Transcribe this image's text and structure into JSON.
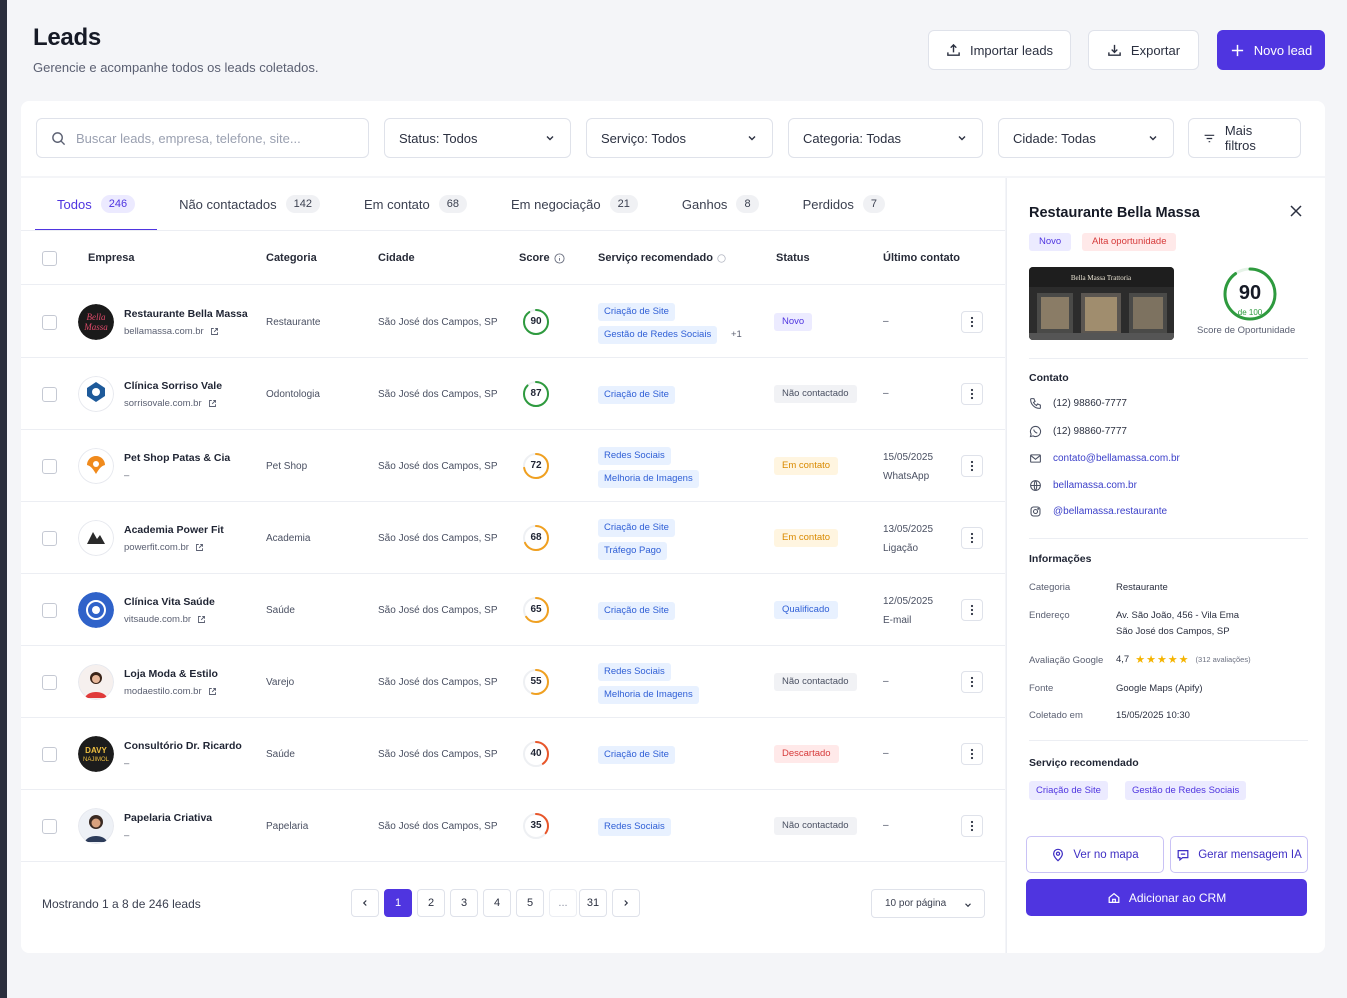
{
  "header": {
    "title": "Leads",
    "subtitle": "Gerencie e acompanhe todos os leads coletados.",
    "import_label": "Importar leads",
    "export_label": "Exportar",
    "new_label": "Novo lead"
  },
  "filters": {
    "search_placeholder": "Buscar leads, empresa, telefone, site...",
    "status": "Status: Todos",
    "service": "Serviço: Todos",
    "category": "Categoria: Todas",
    "city": "Cidade: Todas",
    "more": "Mais filtros"
  },
  "tabs": [
    {
      "label": "Todos",
      "count": "246"
    },
    {
      "label": "Não contactados",
      "count": "142"
    },
    {
      "label": "Em contato",
      "count": "68"
    },
    {
      "label": "Em negociação",
      "count": "21"
    },
    {
      "label": "Ganhos",
      "count": "8"
    },
    {
      "label": "Perdidos",
      "count": "7"
    }
  ],
  "columns": {
    "company": "Empresa",
    "category": "Categoria",
    "city": "Cidade",
    "score": "Score",
    "service": "Serviço recomendado",
    "status": "Status",
    "last_contact": "Último contato"
  },
  "rows": [
    {
      "name": "Restaurante Bella Massa",
      "site": "bellamassa.com.br",
      "category": "Restaurante",
      "city": "São José dos Campos, SP",
      "score": "90",
      "score_value": 90,
      "score_color": "#2e9a3e",
      "services": [
        "Criação de Site",
        "Gestão de Redes Sociais"
      ],
      "extra": "+1",
      "status": "Novo",
      "status_bg": "#ecebff",
      "status_fg": "#4f35e0",
      "last1": "–",
      "last2": ""
    },
    {
      "name": "Clínica Sorriso Vale",
      "site": "sorrisovale.com.br",
      "category": "Odontologia",
      "city": "São José dos Campos, SP",
      "score": "87",
      "score_value": 87,
      "score_color": "#2e9a3e",
      "services": [
        "Criação de Site"
      ],
      "extra": "",
      "status": "Não contactado",
      "status_bg": "#f1f2f5",
      "status_fg": "#4a5062",
      "last1": "–",
      "last2": ""
    },
    {
      "name": "Pet Shop Patas & Cia",
      "site": "–",
      "category": "Pet Shop",
      "city": "São José dos Campos, SP",
      "score": "72",
      "score_value": 72,
      "score_color": "#f0a020",
      "services": [
        "Redes Sociais",
        "Melhoria de Imagens"
      ],
      "extra": "",
      "status": "Em contato",
      "status_bg": "#fff5e0",
      "status_fg": "#d98a00",
      "last1": "15/05/2025",
      "last2": "WhatsApp"
    },
    {
      "name": "Academia Power Fit",
      "site": "powerfit.com.br",
      "category": "Academia",
      "city": "São José dos Campos, SP",
      "score": "68",
      "score_value": 68,
      "score_color": "#f0a020",
      "services": [
        "Criação de Site",
        "Tráfego Pago"
      ],
      "extra": "",
      "status": "Em contato",
      "status_bg": "#fff5e0",
      "status_fg": "#d98a00",
      "last1": "13/05/2025",
      "last2": "Ligação"
    },
    {
      "name": "Clínica Vita Saúde",
      "site": "vitsaude.com.br",
      "category": "Saúde",
      "city": "São José dos Campos, SP",
      "score": "65",
      "score_value": 65,
      "score_color": "#f0a020",
      "services": [
        "Criação de Site"
      ],
      "extra": "",
      "status": "Qualificado",
      "status_bg": "#e8f1ff",
      "status_fg": "#2f5fd6",
      "last1": "12/05/2025",
      "last2": "E-mail"
    },
    {
      "name": "Loja Moda & Estilo",
      "site": "modaestilo.com.br",
      "category": "Varejo",
      "city": "São José dos Campos, SP",
      "score": "55",
      "score_value": 55,
      "score_color": "#f0a020",
      "services": [
        "Redes Sociais",
        "Melhoria de Imagens"
      ],
      "extra": "",
      "status": "Não contactado",
      "status_bg": "#f1f2f5",
      "status_fg": "#4a5062",
      "last1": "–",
      "last2": ""
    },
    {
      "name": "Consultório Dr. Ricardo",
      "site": "–",
      "category": "Saúde",
      "city": "São José dos Campos, SP",
      "score": "40",
      "score_value": 40,
      "score_color": "#e8562a",
      "services": [
        "Criação de Site"
      ],
      "extra": "",
      "status": "Descartado",
      "status_bg": "#ffe9e9",
      "status_fg": "#d63a3a",
      "last1": "–",
      "last2": ""
    },
    {
      "name": "Papelaria Criativa",
      "site": "–",
      "category": "Papelaria",
      "city": "São José dos Campos, SP",
      "score": "35",
      "score_value": 35,
      "score_color": "#e8562a",
      "services": [
        "Redes Sociais"
      ],
      "extra": "",
      "status": "Não contactado",
      "status_bg": "#f1f2f5",
      "status_fg": "#4a5062",
      "last1": "–",
      "last2": ""
    }
  ],
  "pagination": {
    "summary": "Mostrando 1 a 8 de 246 leads",
    "pages": [
      "1",
      "2",
      "3",
      "4",
      "5",
      "...",
      "31"
    ],
    "per_page": "10 por página"
  },
  "detail": {
    "title": "Restaurante Bella Massa",
    "badge_new": "Novo",
    "badge_opportunity": "Alta oportunidade",
    "photo_sign": "Bella Massa Trattoria",
    "score": "90",
    "score_value": 90,
    "score_sub": "de 100",
    "score_label": "Score de Oportunidade",
    "contact_title": "Contato",
    "phone": "(12) 98860-7777",
    "whatsapp": "(12) 98860-7777",
    "email": "contato@bellamassa.com.br",
    "website": "bellamassa.com.br",
    "instagram": "@bellamassa.restaurante",
    "info_title": "Informações",
    "info": {
      "category_key": "Categoria",
      "category_val": "Restaurante",
      "address_key": "Endereço",
      "address_val1": "Av. São João, 456 - Vila Ema",
      "address_val2": "São José dos Campos, SP",
      "rating_key": "Avaliação Google",
      "rating_val": "4,7",
      "stars": "★★★★★",
      "rating_count": "(312 avaliações)",
      "source_key": "Fonte",
      "source_val": "Google Maps (Apify)",
      "collected_key": "Coletado em",
      "collected_val": "15/05/2025 10:30"
    },
    "services_title": "Serviço recomendado",
    "services": [
      "Criação de Site",
      "Gestão de Redes Sociais"
    ],
    "map_btn": "Ver no mapa",
    "ai_btn": "Gerar mensagem IA",
    "crm_btn": "Adicionar ao CRM"
  }
}
